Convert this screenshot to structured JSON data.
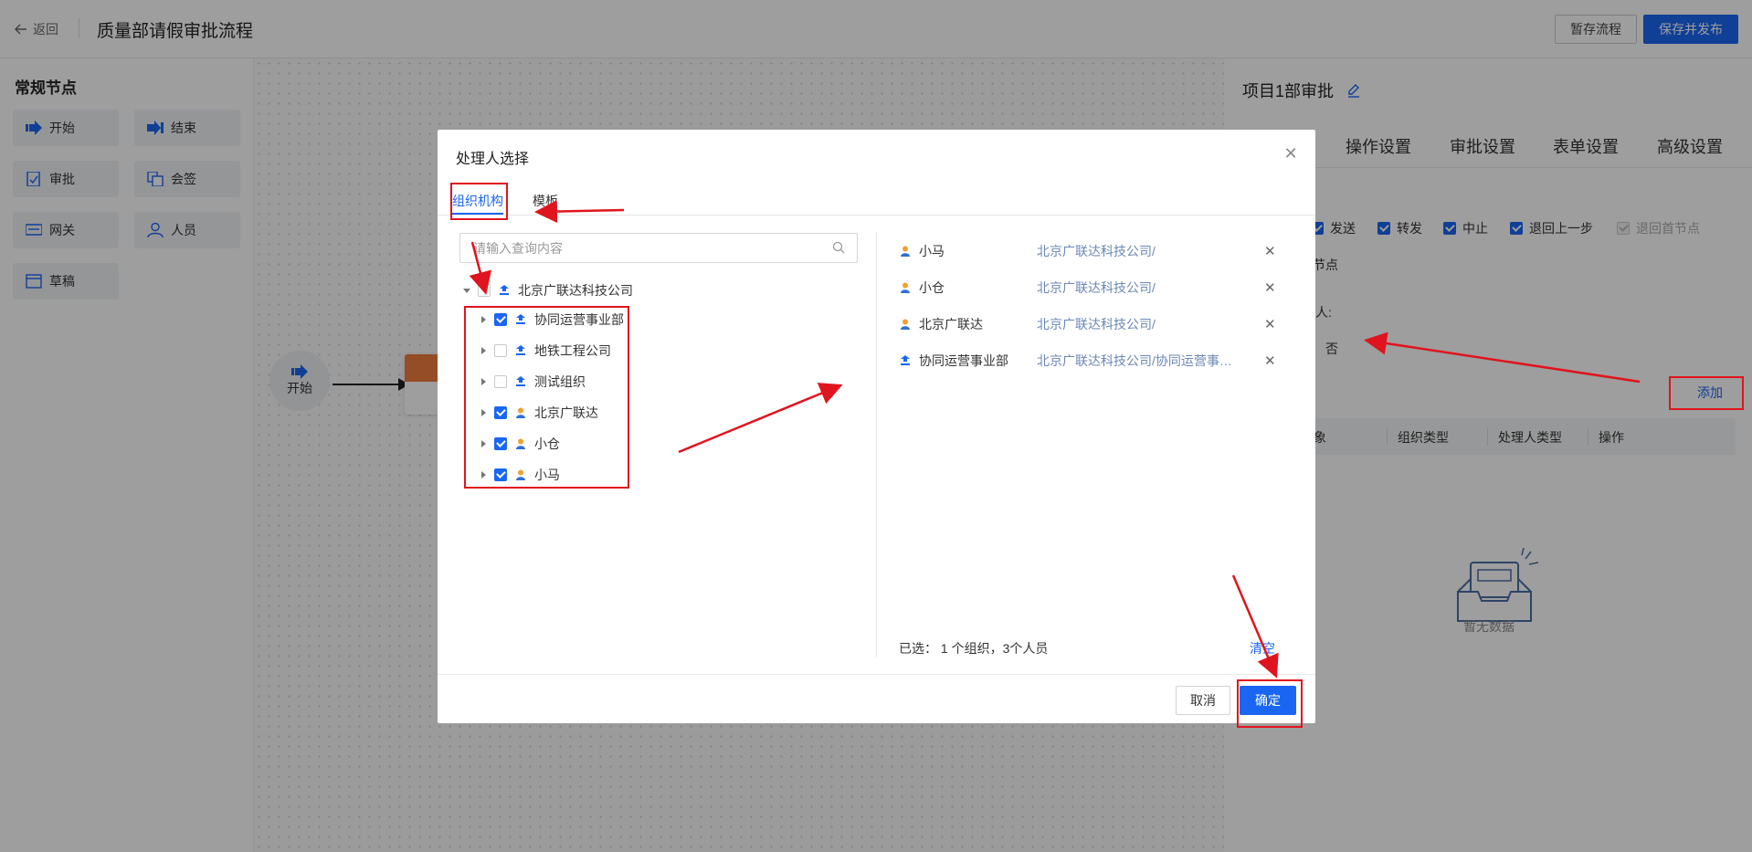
{
  "topbar": {
    "back_label": "返回",
    "title": "质量部请假审批流程",
    "draft_label": "暂存流程",
    "publish_label": "保存并发布"
  },
  "left_panel": {
    "title": "常规节点",
    "nodes": [
      {
        "label": "开始",
        "icon": "start-arrow-icon"
      },
      {
        "label": "结束",
        "icon": "end-arrow-icon"
      },
      {
        "label": "审批",
        "icon": "approve-doc-icon"
      },
      {
        "label": "会签",
        "icon": "countersign-icon"
      },
      {
        "label": "网关",
        "icon": "gateway-icon"
      },
      {
        "label": "人员",
        "icon": "person-icon"
      },
      {
        "label": "草稿",
        "icon": "draft-icon"
      }
    ]
  },
  "canvas": {
    "start_label": "开始"
  },
  "right_panel": {
    "title": "项目1部审批",
    "tabs": [
      "操作设置",
      "审批设置",
      "表单设置",
      "高级设置"
    ],
    "checks": [
      {
        "label": "发送",
        "checked": true
      },
      {
        "label": "转发",
        "checked": true
      },
      {
        "label": "中止",
        "checked": true
      },
      {
        "label": "退回上一步",
        "checked": true
      },
      {
        "label": "退回首节点",
        "checked": true,
        "disabled": true
      }
    ],
    "node_label": "节点",
    "handler_label": "人:",
    "no_label": "否",
    "add_label": "添加",
    "table_headers": [
      "象",
      "组织类型",
      "处理人类型",
      "操作"
    ],
    "empty_text": "暂无数据"
  },
  "modal": {
    "title": "处理人选择",
    "tabs": [
      "组织机构",
      "模板"
    ],
    "search_placeholder": "请输入查询内容",
    "tree": {
      "root": {
        "label": "北京广联达科技公司",
        "checked": false,
        "type": "org"
      },
      "children": [
        {
          "label": "协同运营事业部",
          "checked": true,
          "type": "org"
        },
        {
          "label": "地铁工程公司",
          "checked": false,
          "type": "org"
        },
        {
          "label": "测试组织",
          "checked": false,
          "type": "org"
        },
        {
          "label": "北京广联达",
          "checked": true,
          "type": "person"
        },
        {
          "label": "小仓",
          "checked": true,
          "type": "person"
        },
        {
          "label": "小马",
          "checked": true,
          "type": "person"
        }
      ]
    },
    "selected": [
      {
        "name": "小马",
        "path": "北京广联达科技公司/",
        "type": "person"
      },
      {
        "name": "小仓",
        "path": "北京广联达科技公司/",
        "type": "person"
      },
      {
        "name": "北京广联达",
        "path": "北京广联达科技公司/",
        "type": "person"
      },
      {
        "name": "协同运营事业部",
        "path": "北京广联达科技公司/协同运营事业部",
        "type": "org"
      }
    ],
    "summary": "已选： 1 个组织，3个人员",
    "clear_label": "清空",
    "cancel_label": "取消",
    "ok_label": "确定"
  },
  "colors": {
    "primary": "#1a66f2",
    "annotation_red": "#e0141e",
    "node_orange": "#f07c3c"
  }
}
